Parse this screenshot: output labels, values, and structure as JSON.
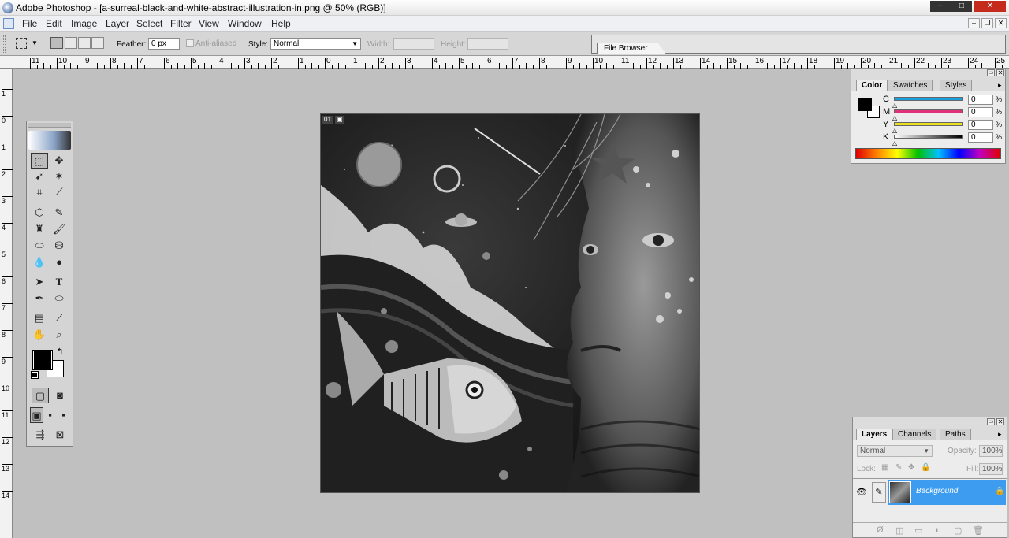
{
  "window": {
    "title": "Adobe Photoshop - [a-surreal-black-and-white-abstract-illustration-in.png @ 50% (RGB)]",
    "controls": [
      "–",
      "□",
      "✕"
    ]
  },
  "menu": [
    "File",
    "Edit",
    "Image",
    "Layer",
    "Select",
    "Filter",
    "View",
    "Window",
    "Help"
  ],
  "options": {
    "feather_label": "Feather:",
    "feather_value": "0 px",
    "antialiased_label": "Anti-aliased",
    "style_label": "Style:",
    "style_value": "Normal",
    "width_label": "Width:",
    "height_label": "Height:",
    "file_browser_tab": "File Browser"
  },
  "ruler": {
    "h_numbers": [
      "11",
      "10",
      "9",
      "8",
      "7",
      "6",
      "5",
      "4",
      "3",
      "2",
      "1",
      "0",
      "1",
      "2",
      "3",
      "4",
      "5",
      "6",
      "7",
      "8",
      "9",
      "10",
      "11",
      "12",
      "13",
      "14",
      "15",
      "16",
      "17",
      "18",
      "19",
      "20",
      "21",
      "22",
      "23",
      "24",
      "25"
    ],
    "v_numbers": [
      "1",
      "0",
      "1",
      "2",
      "3",
      "4",
      "5",
      "6",
      "7",
      "8",
      "9",
      "10",
      "11",
      "12",
      "13",
      "14"
    ]
  },
  "document": {
    "badges": [
      "01",
      "▣"
    ],
    "image_description_icon": "surreal-illustration"
  },
  "color_panel": {
    "tabs": [
      "Color",
      "Swatches",
      "Styles"
    ],
    "channels": [
      {
        "label": "C",
        "value": "0",
        "unit": "%",
        "color": "#1aa0e0"
      },
      {
        "label": "M",
        "value": "0",
        "unit": "%",
        "color": "#e0307a"
      },
      {
        "label": "Y",
        "value": "0",
        "unit": "%",
        "color": "#e8e020"
      },
      {
        "label": "K",
        "value": "0",
        "unit": "%",
        "color": "#202020"
      }
    ],
    "foreground": "#000000",
    "background": "#ffffff"
  },
  "layers_panel": {
    "tabs": [
      "Layers",
      "Channels",
      "Paths"
    ],
    "blend_mode": "Normal",
    "opacity_label": "Opacity:",
    "opacity_value": "100%",
    "lock_label": "Lock:",
    "fill_label": "Fill:",
    "fill_value": "100%",
    "layer_name": "Background",
    "selection_color": "#3d9cf0"
  }
}
